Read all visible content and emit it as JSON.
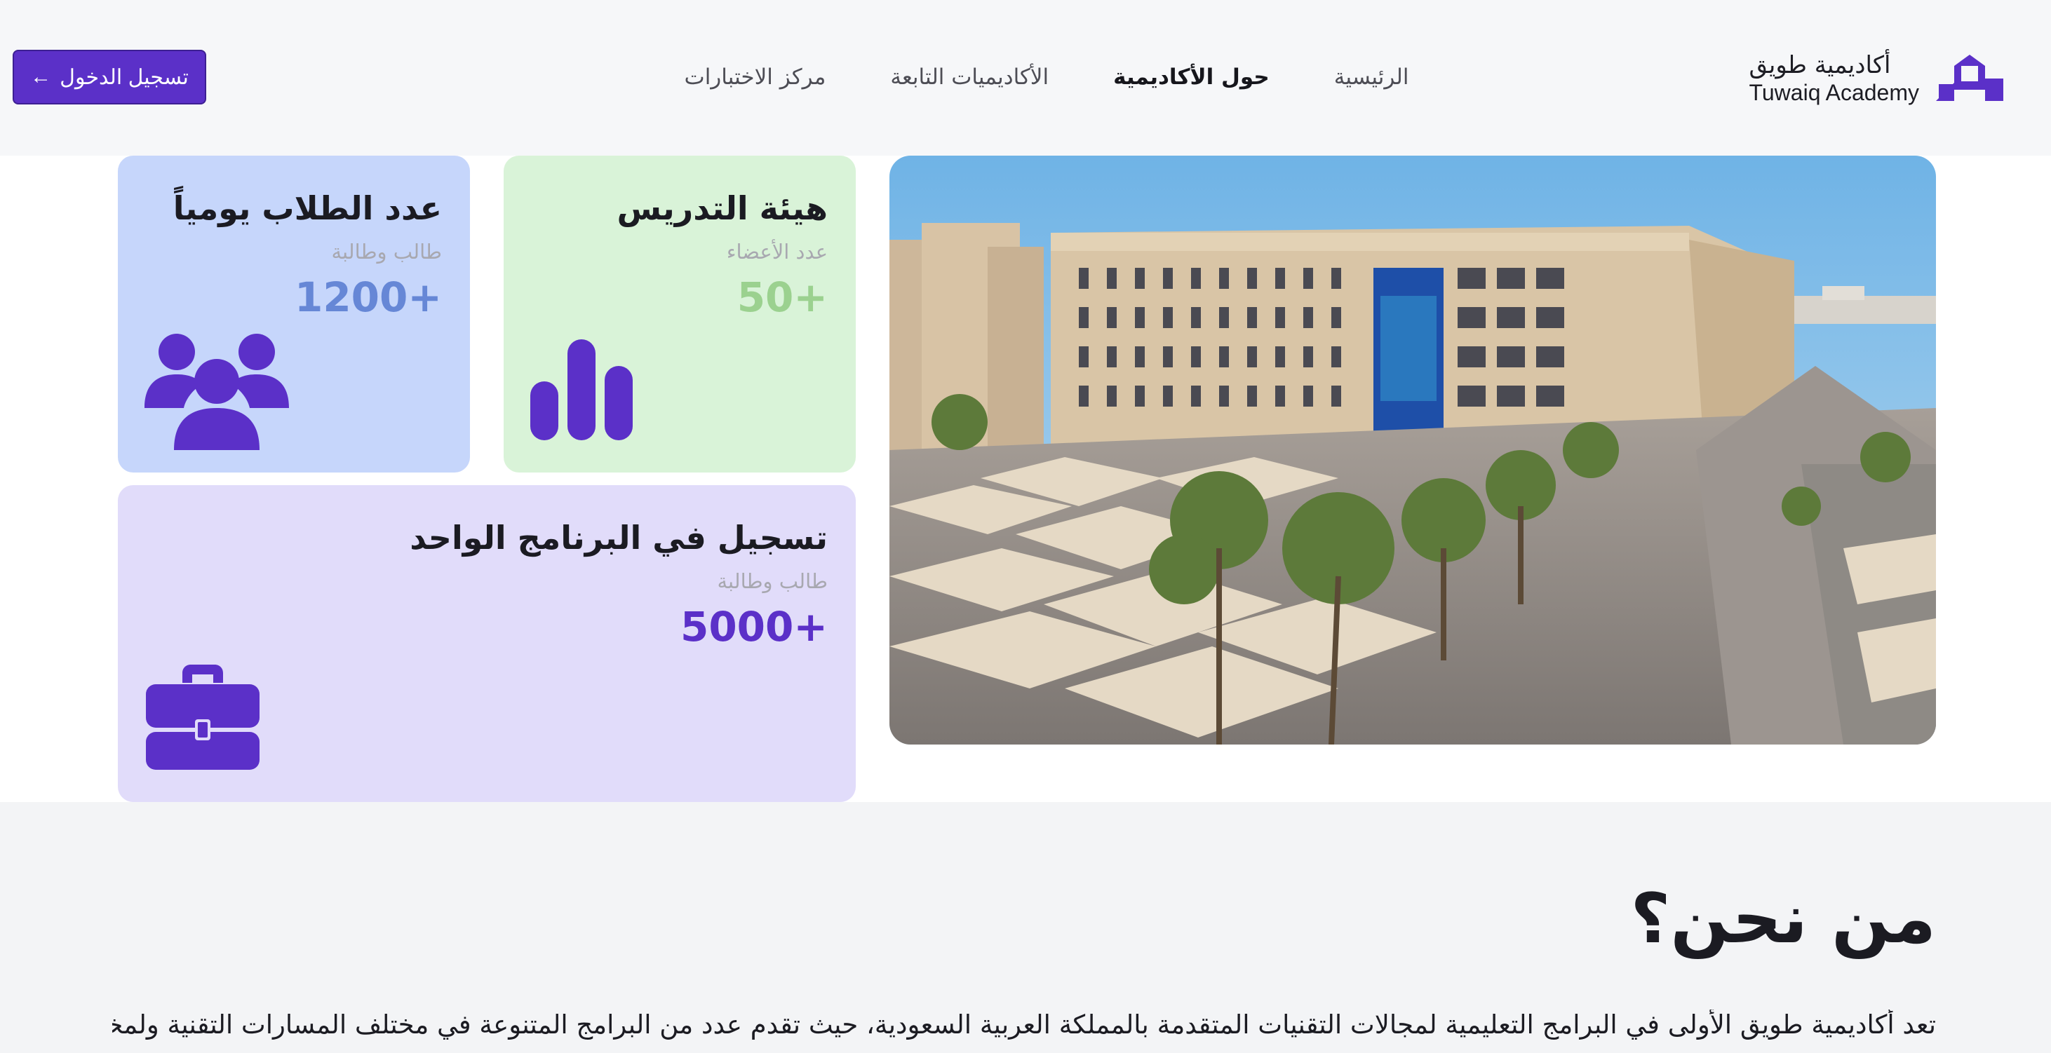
{
  "header": {
    "logo": {
      "name_ar": "أكاديمية طويق",
      "name_en": "Tuwaiq Academy",
      "icon": "tuwaiq-logo-mark",
      "color": "#5b30c8"
    },
    "nav": [
      {
        "label": "الرئيسية",
        "active": false
      },
      {
        "label": "حول الأكاديمية",
        "active": true
      },
      {
        "label": "الأكاديميات التابعة",
        "active": false
      },
      {
        "label": "مركز الاختبارات",
        "active": false
      }
    ],
    "login": {
      "label": "تسجيل الدخول",
      "arrow": "←",
      "icon": "arrow-left-icon"
    }
  },
  "stats": {
    "students": {
      "title": "عدد الطلاب يومياً",
      "subtitle": "طالب وطالبة",
      "value": "1200+",
      "icon": "users-group-icon",
      "bg": "#c6d6fb",
      "value_color": "#6687d6"
    },
    "faculty": {
      "title": "هيئة التدريس",
      "subtitle": "عدد الأعضاء",
      "value": "50+",
      "icon": "bar-chart-icon",
      "bg": "#d9f3d8",
      "value_color": "#9bd18f"
    },
    "enrollment": {
      "title": "تسجيل في البرنامج الواحد",
      "subtitle": "طالب وطالبة",
      "value": "5000+",
      "icon": "briefcase-icon",
      "bg": "#e1dcfa",
      "value_color": "#5b30c8"
    },
    "campus_image": "campus-photo"
  },
  "about": {
    "title": "من نحن؟",
    "text": "تعد أكاديمية طويق الأولى في البرامج التعليمية لمجالات التقنيات المتقدمة بالمملكة العربية السعودية، حيث تقدم عدد من البرامج المتنوعة في مختلف المسارات التقنية ولمختلف"
  },
  "colors": {
    "accent": "#5b30c8",
    "header_bg": "#f6f7f9",
    "about_bg": "#f3f4f6"
  }
}
